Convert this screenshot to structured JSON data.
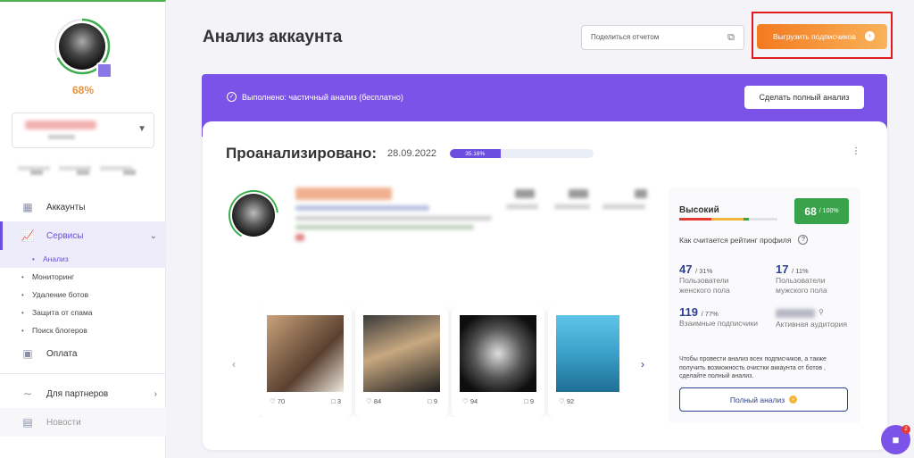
{
  "sidebar": {
    "profile_percent": "68%",
    "items": [
      {
        "label": "Аккаунты"
      },
      {
        "label": "Сервисы"
      },
      {
        "label": "Оплата"
      },
      {
        "label": "Для партнеров"
      },
      {
        "label": "Новости"
      }
    ],
    "subitems": [
      {
        "label": "Анализ"
      },
      {
        "label": "Мониторинг"
      },
      {
        "label": "Удаление ботов"
      },
      {
        "label": "Защита от спама"
      },
      {
        "label": "Поиск блогеров"
      }
    ]
  },
  "header": {
    "title": "Анализ аккаунта",
    "share_label": "Поделиться отчетом",
    "export_label": "Выгрузить подписчиков"
  },
  "banner": {
    "status_text": "Выполнено: частичный анализ (бесплатно)",
    "full_button": "Сделать полный анализ"
  },
  "analysis": {
    "title": "Проанализировано:",
    "date": "28.09.2022",
    "progress_label": "35.16%",
    "progress_value": 35.16
  },
  "posts": [
    {
      "likes": "70",
      "comments": "3"
    },
    {
      "likes": "84",
      "comments": "9"
    },
    {
      "likes": "94",
      "comments": "9"
    },
    {
      "likes": "92",
      "comments": ""
    }
  ],
  "rating": {
    "level": "Высокий",
    "score": "68",
    "score_max": "/ 100%",
    "how_calculated": "Как считается рейтинг профиля",
    "stats": [
      {
        "value": "47",
        "pct": "/ 31%",
        "label": "Пользователи женского пола"
      },
      {
        "value": "17",
        "pct": "/ 11%",
        "label": "Пользователи мужского пола"
      },
      {
        "value": "119",
        "pct": "/ 77%",
        "label": "Взаимные подписчики"
      },
      {
        "value": "",
        "pct": "",
        "label": "Активная аудитория"
      }
    ],
    "note": "Чтобы провести анализ всех подписчиков, а также получить возможность очистки аккаунта от ботов , сделайте полный анализ.",
    "button": "Полный анализ"
  },
  "chat": {
    "badge": "2"
  },
  "colors": {
    "accent": "#7b53e8",
    "export": "#f37a1f",
    "score": "#39a34b",
    "highlight": "#e01b1b"
  }
}
